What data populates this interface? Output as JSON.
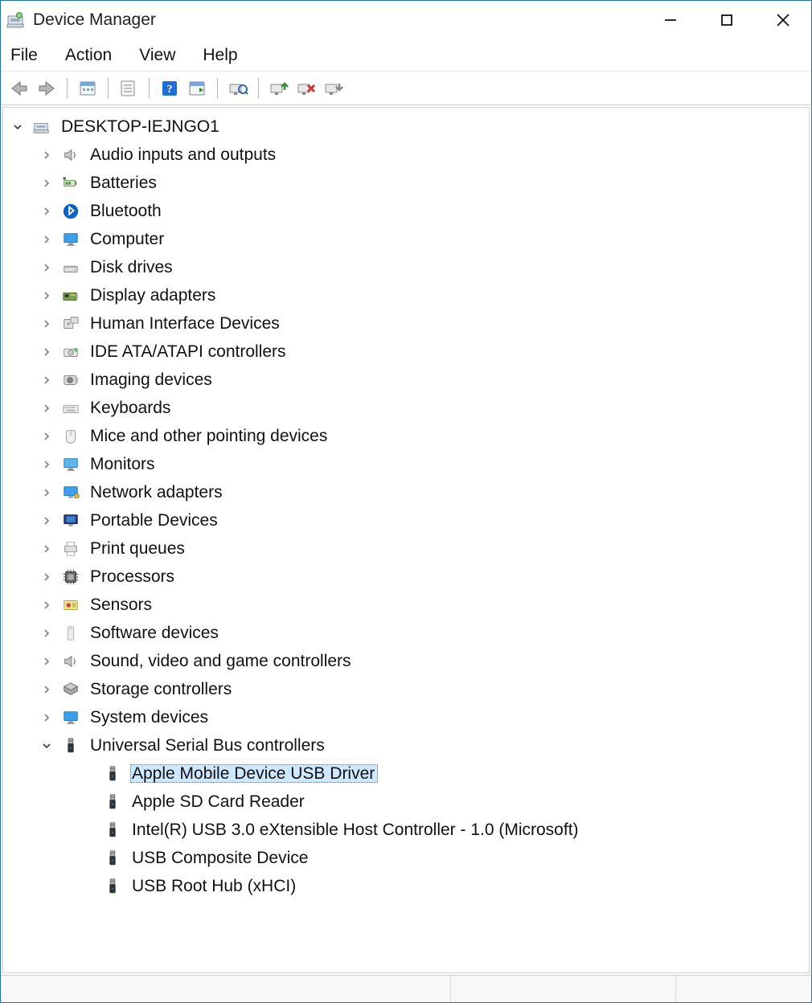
{
  "window": {
    "title": "Device Manager"
  },
  "menu": {
    "file": "File",
    "action": "Action",
    "view": "View",
    "help": "Help"
  },
  "tree": {
    "root": "DESKTOP-IEJNGO1",
    "categories": [
      {
        "label": "Audio inputs and outputs",
        "icon": "speaker"
      },
      {
        "label": "Batteries",
        "icon": "battery"
      },
      {
        "label": "Bluetooth",
        "icon": "bluetooth"
      },
      {
        "label": "Computer",
        "icon": "monitor"
      },
      {
        "label": "Disk drives",
        "icon": "disk"
      },
      {
        "label": "Display adapters",
        "icon": "card"
      },
      {
        "label": "Human Interface Devices",
        "icon": "hid"
      },
      {
        "label": "IDE ATA/ATAPI controllers",
        "icon": "ide"
      },
      {
        "label": "Imaging devices",
        "icon": "camera"
      },
      {
        "label": "Keyboards",
        "icon": "keyboard"
      },
      {
        "label": "Mice and other pointing devices",
        "icon": "mouse"
      },
      {
        "label": "Monitors",
        "icon": "monitor2"
      },
      {
        "label": "Network adapters",
        "icon": "network"
      },
      {
        "label": "Portable Devices",
        "icon": "portable"
      },
      {
        "label": "Print queues",
        "icon": "printer"
      },
      {
        "label": "Processors",
        "icon": "cpu"
      },
      {
        "label": "Sensors",
        "icon": "sensor"
      },
      {
        "label": "Software devices",
        "icon": "software"
      },
      {
        "label": "Sound, video and game controllers",
        "icon": "speaker"
      },
      {
        "label": "Storage controllers",
        "icon": "storage"
      },
      {
        "label": "System devices",
        "icon": "monitor"
      }
    ],
    "usb": {
      "label": "Universal Serial Bus controllers",
      "icon": "usb",
      "children": [
        {
          "label": "Apple Mobile Device USB Driver",
          "selected": true
        },
        {
          "label": "Apple SD Card Reader"
        },
        {
          "label": "Intel(R) USB 3.0 eXtensible Host Controller - 1.0 (Microsoft)"
        },
        {
          "label": "USB Composite Device"
        },
        {
          "label": "USB Root Hub (xHCI)"
        }
      ]
    }
  }
}
